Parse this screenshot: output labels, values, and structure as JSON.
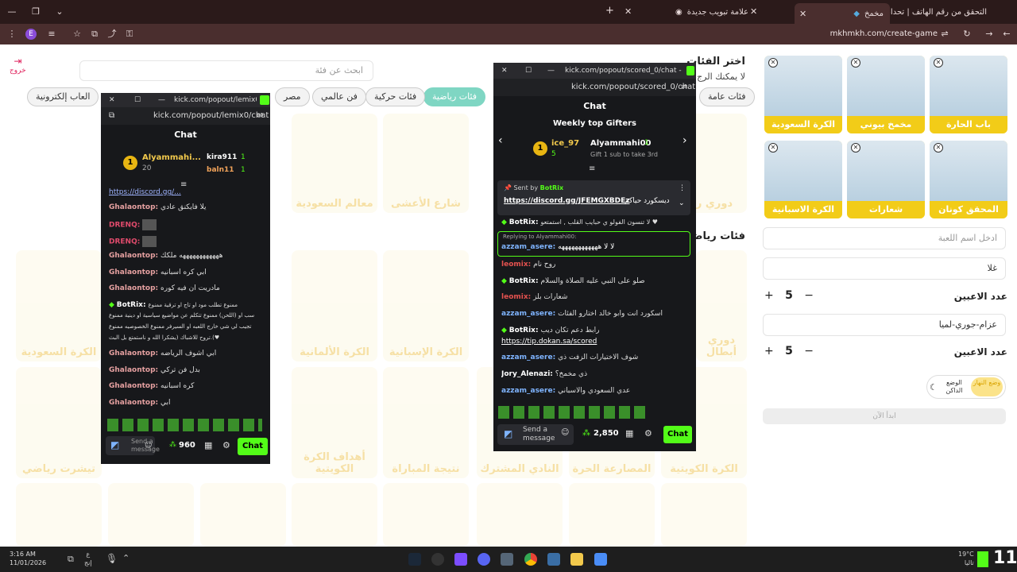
{
  "browser": {
    "tabs": [
      {
        "title": "التحقق من رقم الهاتف | تحداني",
        "active": false
      },
      {
        "title": "مخمخ",
        "active": true
      },
      {
        "title": "علامة تبويب جديدة",
        "active": false
      }
    ],
    "new_tab": "+",
    "url": "mkhmkh.com/create-game",
    "profile": "E"
  },
  "site": {
    "logout_label": "خروج",
    "search_placeholder": "ابحث عن فئة",
    "heading": "اختر الفئات",
    "subheading": "لا يمكنك الرج",
    "section_heading": "فئات رياض",
    "chips": [
      "فئات عامة",
      "فئات رياضية",
      "فئات حركية",
      "فن عالمي",
      "مصر",
      "العاب إلكترونية"
    ],
    "row1_cards": [
      "معالم السعودية",
      "شارع الأعشى",
      "دوري روش"
    ],
    "row2_cards": [
      "الكرة السعودية",
      "الكرة الألمانية",
      "الكرة الإسبانية",
      "دوري أبطال"
    ],
    "row3_cards": [
      "تيشرت رياضي",
      "أهداف الكرة الكويتية",
      "نتيجة المباراة",
      "النادي المشترك",
      "المصارعة الحرة",
      "الكرة الكويتية"
    ],
    "selected_cards": [
      {
        "label": "الكرة السعودية"
      },
      {
        "label": "مخمخ بيوني"
      },
      {
        "label": "باب الحارة"
      },
      {
        "label": "الكرة الاسبانية"
      },
      {
        "label": "شعارات"
      },
      {
        "label": "المحقق كونان"
      }
    ],
    "game_name_placeholder": "ادخل اسم اللعبة",
    "team1_name": "غلا",
    "team1_players_label": "عدد الاعبين",
    "team1_players": "5",
    "team2_name": "عزام-جوري-لميا",
    "team2_players_label": "عدد الاعبين",
    "team2_players": "5",
    "dark_mode_label": "الوضع الداكن",
    "day_mode_label": "وضع النهار",
    "start_label": "ابدأ الآن",
    "plus": "+",
    "minus": "−"
  },
  "popup_left": {
    "titlebar": "kick.com/popout/lemix0/ch...",
    "url": "kick.com/popout/lemix0/chat",
    "header": "Chat",
    "leaders": [
      {
        "rank": "1",
        "name": "Alyammahi...",
        "count": "20"
      },
      {
        "name": "kira911",
        "count": "1"
      },
      {
        "name": "baln11",
        "count": "1"
      }
    ],
    "messages": [
      {
        "user": "",
        "text": "https://discord.gg/... "
      },
      {
        "user": "Ghalaontop:",
        "text": "يلا فايكنق عادي"
      },
      {
        "user": "DRENQ:",
        "text": ""
      },
      {
        "user": "DRENQ:",
        "text": ""
      },
      {
        "user": "Ghalaontop:",
        "text": "ههههههههههههه ملكك"
      },
      {
        "user": "Ghalaontop:",
        "text": "أبي كره اسبانيه"
      },
      {
        "user": "Ghalaontop:",
        "text": "مادريت ان فيه كوره"
      },
      {
        "user": "BotRix:",
        "text": "ممنوع تطلب مود او تاج او ترقية ممنوع"
      },
      {
        "user": "",
        "text": "سب او (اللحن) ممنوع تتكلم عن مواضيع سياسية او دينية ممنوع"
      },
      {
        "user": "",
        "text": "تجيب لي شي خارج اللعبه او السيرفر ممنوع الخصوصيه ممنوع"
      },
      {
        "user": "",
        "text": "تروح للاشباك (يشكرا الله و ناستمتع بل البث.(♥"
      },
      {
        "user": "Ghalaontop:",
        "text": "أبي اشوف الرياضه"
      },
      {
        "user": "Ghalaontop:",
        "text": "بدل فن تركي"
      },
      {
        "user": "Ghalaontop:",
        "text": "كره اسبانيه"
      },
      {
        "user": "Ghalaontop:",
        "text": "ابي"
      }
    ],
    "send_placeholder": "Send a message",
    "points": "960",
    "chat_button": "Chat"
  },
  "popup_right": {
    "titlebar": "kick.com/popout/scored_0/chat - Googl...",
    "url": "kick.com/popout/scored_0/chat",
    "header": "Chat",
    "gifters_title": "Weekly top Gifters",
    "gifters": [
      {
        "rank": "1",
        "name": "ice_97",
        "count": "5"
      },
      {
        "name": "Alyammahi00",
        "count": "1"
      }
    ],
    "gift_hint": "Gift 1 sub to take 3rd",
    "pinned_by_label": "Sent by",
    "pinned_by": "BotRix",
    "pinned_link": "https://discord.gg/JFEMGXBDEz",
    "pinned_text": "ديسكورد حياكم",
    "reply_to": "Replying to Alyammahi00:",
    "messages": [
      {
        "user": "BotRix:",
        "text": "لا تنسون الفولو ي حبايب القلب , استمتعو ♥"
      },
      {
        "user": "azzam_asere:",
        "text": "لا لا ههههههههههههه"
      },
      {
        "user": "leomix:",
        "text": "روح نام"
      },
      {
        "user": "BotRix:",
        "text": "صلو على النبي عليه الصلاة والسلام"
      },
      {
        "user": "leomix:",
        "text": "شعارات بلز"
      },
      {
        "user": "azzam_asere:",
        "text": "اسكورد انت وابو خالد اختارو الفئات"
      },
      {
        "user": "BotRix:",
        "text": "رابط دعم تكان ديب"
      },
      {
        "user": "",
        "text": "https://tip.dokan.sa/scored"
      },
      {
        "user": "azzam_asere:",
        "text": "شوف الاختيارات الزفت ذي"
      },
      {
        "user": "Jory_Alenazi:",
        "text": "ذي مخمخ؟"
      },
      {
        "user": "azzam_asere:",
        "text": "عدي السعودي والاسباني"
      }
    ],
    "send_placeholder": "Send a message",
    "points": "2,850",
    "chat_button": "Chat"
  },
  "taskbar": {
    "time": "3:16 AM",
    "date": "11/01/2026",
    "lang": "ع",
    "lang2": "إنج",
    "weather": "تاليا",
    "temp": "19°C"
  },
  "colors": {
    "kick_green": "#53fc18",
    "brand_yellow": "#f2cc18",
    "chip_selected": "#7fd6c3"
  }
}
